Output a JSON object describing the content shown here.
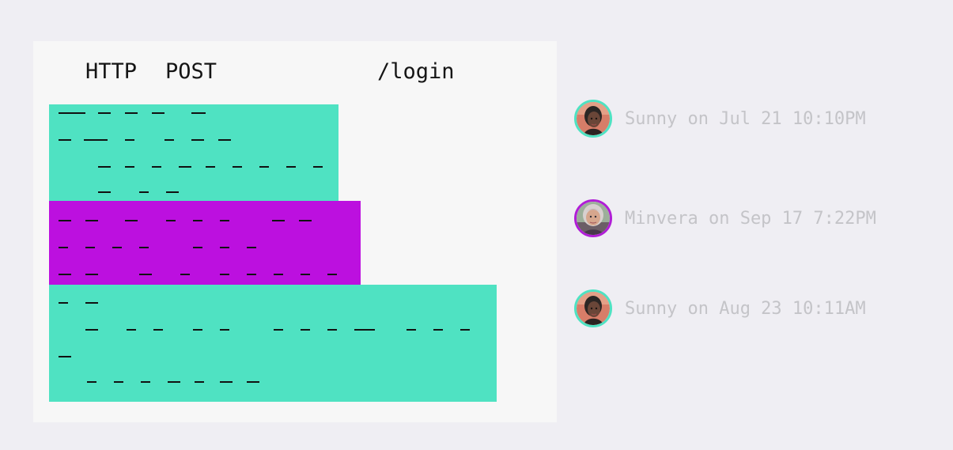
{
  "request": {
    "protocol": "HTTP",
    "method": "POST",
    "path": "/login"
  },
  "colors": {
    "background": "#efeef3",
    "card": "#f7f7f7",
    "teal_block": "#4fe2c2",
    "purple_block": "#bc10df",
    "meta_text": "#c4c4c8"
  },
  "comments": [
    {
      "author": "Sunny",
      "timestamp": "Jul 21 10:10PM",
      "meta": "Sunny on Jul 21 10:10PM",
      "accent": "#4fe2c2",
      "avatar_icon": "sunny-avatar-icon"
    },
    {
      "author": "Minvera",
      "timestamp": "Sep 17 7:22PM",
      "meta": "Minvera on Sep 17 7:22PM",
      "accent": "#b01ed6",
      "avatar_icon": "minvera-avatar-icon"
    },
    {
      "author": "Sunny",
      "timestamp": "Aug 23 10:11AM",
      "meta": "Sunny on Aug 23 10:11AM",
      "accent": "#4fe2c2",
      "avatar_icon": "sunny-avatar-icon"
    }
  ]
}
